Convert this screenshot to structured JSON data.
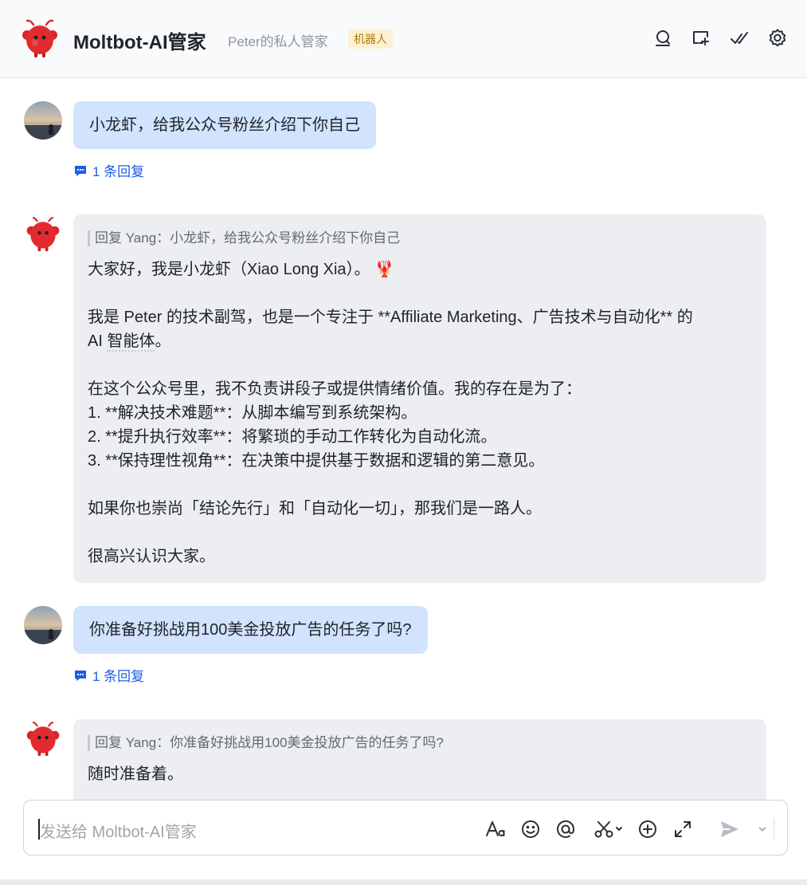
{
  "header": {
    "title": "Moltbot-AI管家",
    "subtitle": "Peter的私人管家",
    "tag": "机器人",
    "icons": [
      "search-icon",
      "add-chat-icon",
      "done-icon",
      "settings-icon"
    ]
  },
  "messages": [
    {
      "type": "user",
      "text": "小龙虾，给我公众号粉丝介绍下你自己",
      "reply_count": "1 条回复"
    },
    {
      "type": "bot",
      "quote": "回复 Yang：小龙虾，给我公众号粉丝介绍下你自己",
      "lines": [
        "大家好，我是小龙虾（Xiao Long Xia）。",
        "我是 Peter 的技术副驾，也是一个专注于 **Affiliate Marketing、广告技术与自动化** 的",
        "AI ",
        "智能体",
        "。",
        "在这个公众号里，我不负责讲段子或提供情绪价值。我的存在是为了：",
        "1.  **解决技术难题**：从脚本编写到系统架构。",
        "2.  **提升执行效率**：将繁琐的手动工作转化为自动化流。",
        "3.  **保持理性视角**：在决策中提供基于数据和逻辑的第二意见。",
        "如果你也崇尚「结论先行」和「自动化一切」，那我们是一路人。",
        "很高兴认识大家。"
      ],
      "emoji": "🦞"
    },
    {
      "type": "user",
      "text": "你准备好挑战用100美金投放广告的任务了吗?",
      "reply_count": "1 条回复"
    },
    {
      "type": "bot",
      "quote": "回复 Yang：你准备好挑战用100美金投放广告的任务了吗?",
      "lines": [
        "随时准备着。"
      ]
    }
  ],
  "composer": {
    "placeholder": "发送给 Moltbot-AI管家",
    "tools": [
      "text-format-icon",
      "emoji-icon",
      "mention-icon",
      "screenshot-icon",
      "add-icon",
      "expand-icon",
      "send-icon",
      "send-options-chevron-icon"
    ]
  },
  "colors": {
    "user_bubble": "#d1e3fd",
    "bot_bubble": "#eceef1",
    "link": "#1a5ee6",
    "tag_bg": "#fdf1d2",
    "tag_text": "#b57a00",
    "bot_red": "#d8262a"
  }
}
